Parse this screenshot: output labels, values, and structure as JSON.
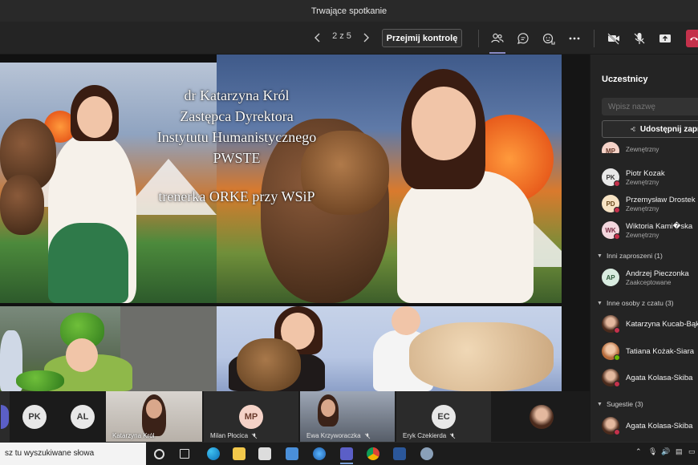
{
  "window": {
    "title": "Trwające spotkanie"
  },
  "toolbar": {
    "page_indicator": "2 z 5",
    "take_control_label": "Przejmij kontrolę"
  },
  "presentation": {
    "lines": [
      "dr Katarzyna Król",
      "Zastępca Dyrektora",
      "Instytutu Humanistycznego",
      "PWSTE"
    ],
    "line2": "trenerka ORKE przy WSiP"
  },
  "strip": {
    "tiles": [
      {
        "initials": "PK"
      },
      {
        "initials": "AL"
      },
      {
        "name": "Katarzyna Król"
      },
      {
        "initials": "MP",
        "name": "Milan Płocica"
      },
      {
        "name": "Ewa Krzyworaczka"
      },
      {
        "initials": "EC",
        "name": "Eryk Czekierda"
      }
    ]
  },
  "panel": {
    "title": "Uczestnicy",
    "search_placeholder": "Wpisz nazwę",
    "share_label": "Udostępnij zapro",
    "people": [
      {
        "initials": "MP",
        "name": "",
        "sub": "Zewnętrzny"
      },
      {
        "initials": "PK",
        "name": "Piotr Kozak",
        "sub": "Zewnętrzny"
      },
      {
        "initials": "PD",
        "name": "Przemysław Drostek",
        "sub": "Zewnętrzny"
      },
      {
        "initials": "WK",
        "name": "Wiktoria Kami�ska",
        "sub": "Zewnętrzny"
      }
    ],
    "section_invited": "Inni zaproszeni (1)",
    "invited": [
      {
        "initials": "AP",
        "name": "Andrzej Pieczonka",
        "sub": "Zaakceptowane"
      }
    ],
    "section_chat": "Inne osoby z czatu (3)",
    "chat": [
      {
        "name": "Katarzyna Kucab-Bąk"
      },
      {
        "name": "Tatiana Kożak-Siara"
      },
      {
        "name": "Agata Kolasa-Skiba"
      }
    ],
    "section_suggestions": "Sugestie (3)",
    "suggestions": [
      {
        "name": "Agata Kolasa-Skiba"
      }
    ]
  },
  "taskbar": {
    "search_text": "sz tu wyszukiwane słowa"
  },
  "colors": {
    "accent": "#8b8cc7",
    "hangup": "#c4314b",
    "status_red": "#c4314b",
    "status_green": "#6bb700"
  }
}
